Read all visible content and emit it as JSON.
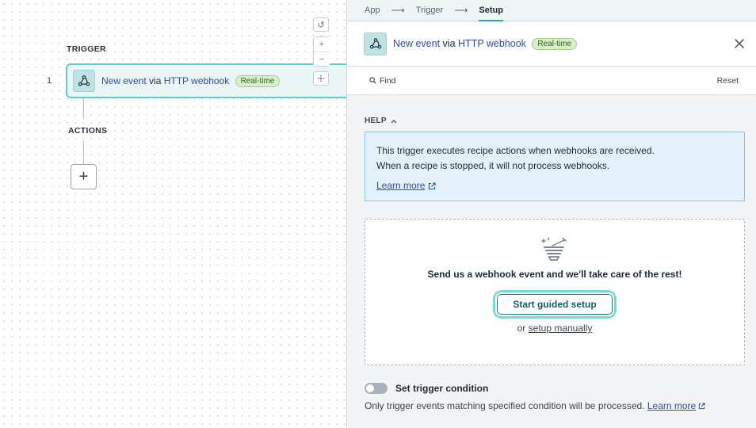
{
  "canvas": {
    "trigger_label": "TRIGGER",
    "actions_label": "ACTIONS",
    "step_number": "1",
    "trigger_card": {
      "event": "New event",
      "via": "via",
      "app": "HTTP webhook",
      "badge": "Real-time"
    },
    "add_step_symbol": "+",
    "zoom": {
      "reset_symbol": "↺",
      "zoom_in_symbol": "+",
      "zoom_out_symbol": "−",
      "fit_symbol": "⤧"
    }
  },
  "panel": {
    "breadcrumb": [
      {
        "label": "App"
      },
      {
        "label": "Trigger"
      },
      {
        "label": "Setup"
      }
    ],
    "breadcrumb_arrow": "⟶",
    "header": {
      "event": "New event",
      "via": "via",
      "app": "HTTP webhook",
      "badge": "Real-time"
    },
    "toolbar": {
      "find_label": "Find",
      "reset_label": "Reset"
    },
    "help": {
      "label": "HELP",
      "line1": "This trigger executes recipe actions when webhooks are received.",
      "line2": "When a recipe is stopped, it will not process webhooks.",
      "learn_more": "Learn more"
    },
    "guided": {
      "message": "Send us a webhook event and we'll take care of the rest!",
      "button_label": "Start guided setup",
      "or_text": "or",
      "manual_link": "setup manually"
    },
    "condition": {
      "label": "Set trigger condition",
      "description": "Only trigger events matching specified condition will be processed.",
      "learn_more": "Learn more"
    }
  },
  "colors": {
    "accent_teal": "#2aa7a2",
    "link_blue": "#2f4da3",
    "badge_green": "#d8f0c8",
    "help_blue": "#e4f1fb"
  },
  "icons": [
    "webhook-icon",
    "search-icon",
    "close-icon",
    "chevron-up-icon",
    "external-link-icon",
    "magic-wand-icon",
    "plus-icon"
  ]
}
